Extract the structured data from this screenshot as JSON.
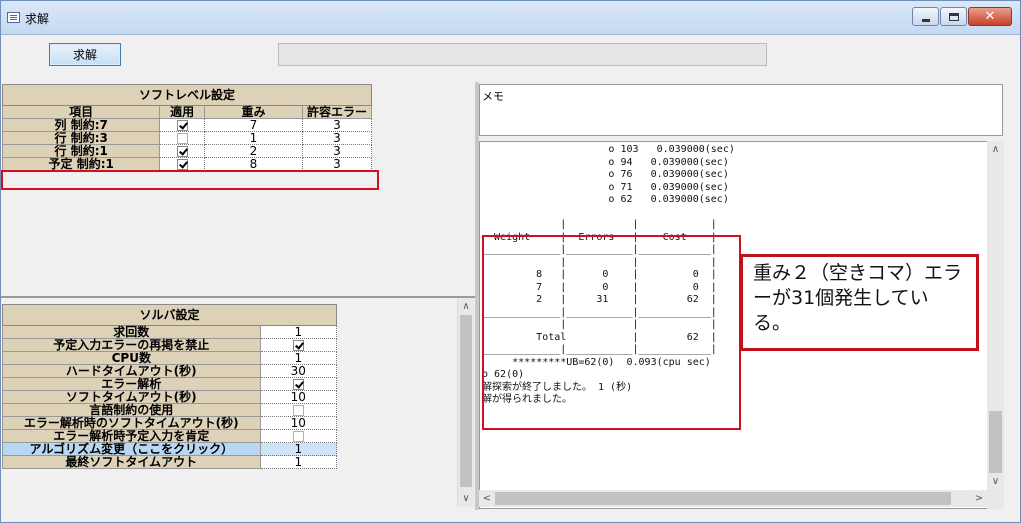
{
  "window": {
    "title": "求解"
  },
  "toolbar": {
    "solve_label": "求解"
  },
  "soft_level": {
    "title": "ソフトレベル設定",
    "columns": [
      "項目",
      "適用",
      "重み",
      "許容エラー"
    ],
    "rows": [
      {
        "item": "列 制約:7",
        "apply": true,
        "weight": "7",
        "tolerance": "3"
      },
      {
        "item": "行 制約:3",
        "apply": false,
        "weight": "1",
        "tolerance": "3"
      },
      {
        "item": "行 制約:1",
        "apply": true,
        "weight": "2",
        "tolerance": "3"
      },
      {
        "item": "予定 制約:1",
        "apply": true,
        "weight": "8",
        "tolerance": "3"
      }
    ]
  },
  "solver": {
    "title": "ソルバ設定",
    "rows": [
      {
        "label": "求回数",
        "value": "1"
      },
      {
        "label": "予定入力エラーの再掲を禁止",
        "check": true
      },
      {
        "label": "CPU数",
        "value": "1"
      },
      {
        "label": "ハードタイムアウト(秒)",
        "value": "30"
      },
      {
        "label": "エラー解析",
        "check": true
      },
      {
        "label": "ソフトタイムアウト(秒)",
        "value": "10"
      },
      {
        "label": "言語制約の使用",
        "check": false
      },
      {
        "label": "エラー解析時のソフトタイムアウト(秒)",
        "value": "10"
      },
      {
        "label": "エラー解析時予定入力を肯定",
        "check": false
      },
      {
        "label": "アルゴリズム変更（ここをクリック）",
        "value": "1"
      },
      {
        "label": "最終ソフトタイムアウト",
        "value": "1"
      }
    ]
  },
  "memo": {
    "label": "メモ"
  },
  "log": {
    "text": "                     o 103   0.039000(sec)\n                     o 94   0.039000(sec)\n                     o 76   0.039000(sec)\n                     o 71   0.039000(sec)\n                     o 62   0.039000(sec)\n\n             |           |            |\n  Weight     |  Errors   |    Cost    |\n_____________|___________|____________|\n             |           |            |\n         8   |      0    |         0  |\n         7   |      0    |         0  |\n         2   |     31    |        62  |\n_____________|___________|____________|\n             |           |            |\n         Total           |        62  |\n_____________|___________|____________|\n     *********UB=62(0)  0.093(cpu sec)\no 62(0)\n解探索が終了しました。 1 (秒)\n解が得られました。"
  },
  "callout": {
    "text": "重み２（空きコマ）エラーが31個発生している。"
  }
}
